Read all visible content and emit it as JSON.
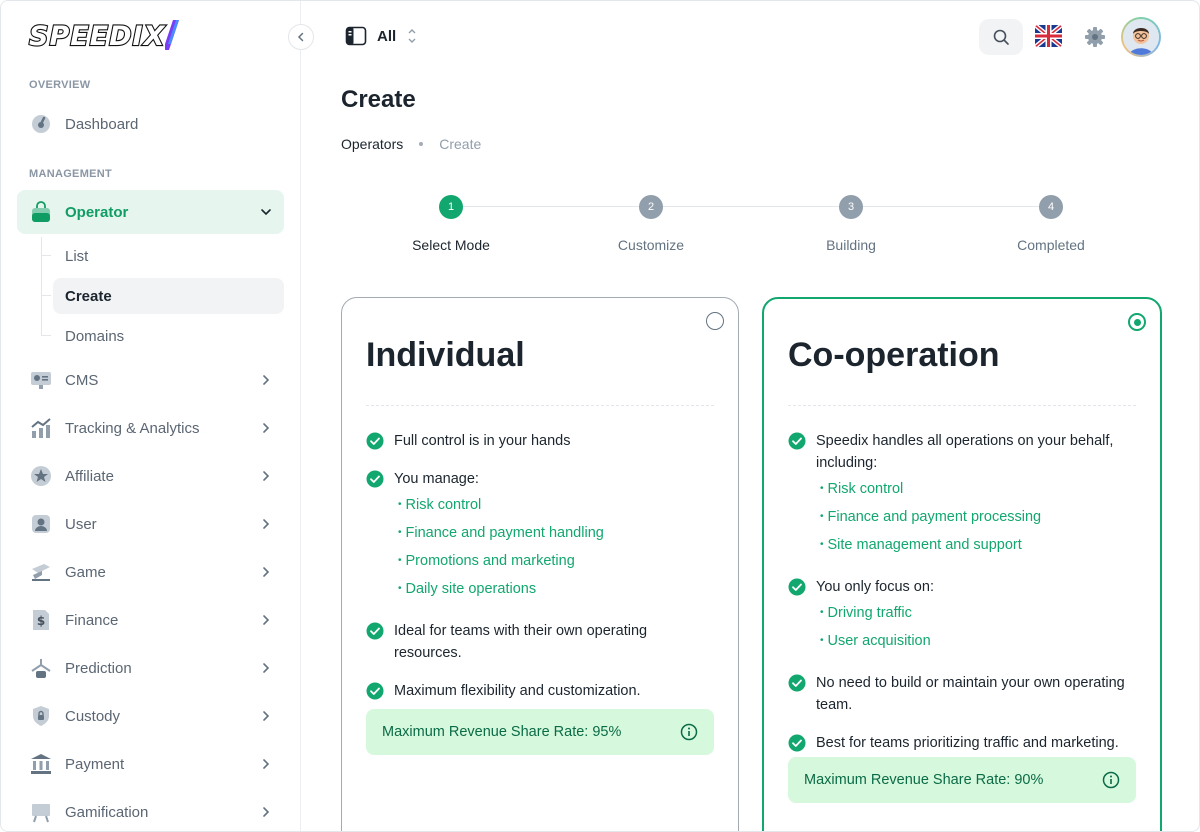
{
  "app": {
    "logo_text": "SPEEDIX"
  },
  "sidebar": {
    "sections": [
      {
        "title": "OVERVIEW"
      },
      {
        "title": "MANAGEMENT"
      }
    ],
    "dashboard": {
      "label": "Dashboard"
    },
    "operator": {
      "label": "Operator",
      "children": [
        {
          "label": "List"
        },
        {
          "label": "Create"
        },
        {
          "label": "Domains"
        }
      ]
    },
    "items": [
      {
        "label": "CMS"
      },
      {
        "label": "Tracking & Analytics"
      },
      {
        "label": "Affiliate"
      },
      {
        "label": "User"
      },
      {
        "label": "Game"
      },
      {
        "label": "Finance"
      },
      {
        "label": "Prediction"
      },
      {
        "label": "Custody"
      },
      {
        "label": "Payment"
      },
      {
        "label": "Gamification"
      }
    ]
  },
  "header": {
    "workspace_label": "All"
  },
  "page": {
    "title": "Create",
    "breadcrumb": [
      "Operators",
      "Create"
    ]
  },
  "stepper": {
    "steps": [
      {
        "number": "1",
        "label": "Select Mode"
      },
      {
        "number": "2",
        "label": "Customize"
      },
      {
        "number": "3",
        "label": "Building"
      },
      {
        "number": "4",
        "label": "Completed"
      }
    ],
    "current_step": 1
  },
  "cards": [
    {
      "title": "Individual",
      "selected": false,
      "features": [
        {
          "text": "Full control is in your hands"
        },
        {
          "text": "You manage:",
          "sub": [
            "Risk control",
            "Finance and payment handling",
            "Promotions and marketing",
            "Daily site operations"
          ]
        },
        {
          "text": "Ideal for teams with their own operating resources."
        },
        {
          "text": "Maximum flexibility and customization."
        }
      ],
      "revenue": "Maximum Revenue Share Rate: 95%"
    },
    {
      "title": "Co-operation",
      "selected": true,
      "features": [
        {
          "text": "Speedix handles all operations on your behalf, including:",
          "sub": [
            "Risk control",
            "Finance and payment processing",
            "Site management and support"
          ]
        },
        {
          "text": "You only focus on:",
          "sub": [
            "Driving traffic",
            "User acquisition"
          ]
        },
        {
          "text": "No need to build or maintain your own operating team."
        },
        {
          "text": "Best for teams prioritizing traffic and marketing."
        }
      ],
      "revenue": "Maximum Revenue Share Rate: 90%"
    }
  ],
  "colors": {
    "accent": "#12a76f",
    "revenue_bg": "#d6f8dc",
    "muted": "#919eab"
  }
}
